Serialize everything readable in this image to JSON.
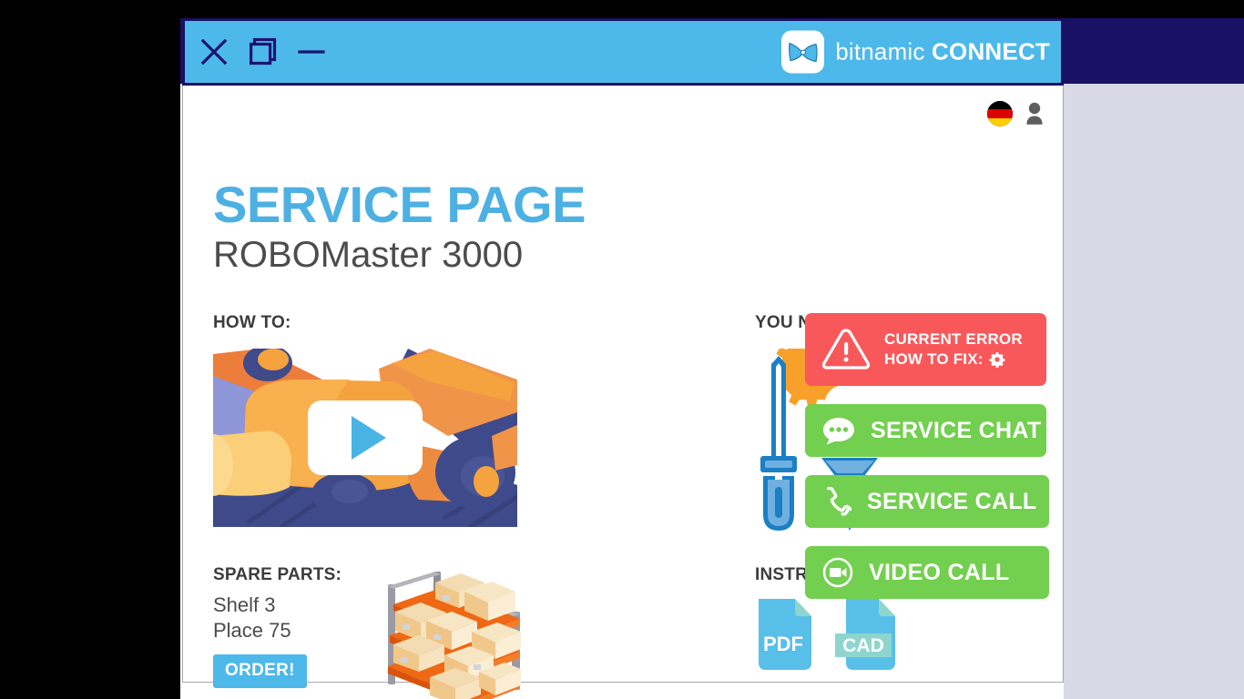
{
  "window": {
    "titlebar": {
      "close_icon": "close-x-icon",
      "restore_icon": "restore-window-icon",
      "minimize_icon": "minimize-dash-icon"
    },
    "brand": {
      "logo_icon": "bitnamic-bowtie-logo-icon",
      "name_light": "bitnamic",
      "name_bold": "CONNECT"
    }
  },
  "account": {
    "language_flag": "germany-flag-icon",
    "language_code": "DE",
    "user_icon": "user-avatar-icon"
  },
  "page": {
    "title": "SERVICE PAGE",
    "subtitle": "ROBOMaster 3000"
  },
  "sections": {
    "how_to": {
      "label": "HOW TO:",
      "video": {
        "thumbnail_alt": "robot-arm-illustration",
        "play_icon": "play-triangle-icon"
      }
    },
    "you_need": {
      "label": "YOU NEED:",
      "tools": [
        "screwdriver-icon",
        "gear-icon",
        "screw-icon"
      ]
    },
    "spare_parts": {
      "label": "SPARE PARTS:",
      "shelf": "Shelf 3",
      "place": "Place 75",
      "order_label": "ORDER!",
      "illustration": "warehouse-shelf-illustration"
    },
    "instructions": {
      "label": "INSTRUCTIONS:",
      "files": [
        {
          "name": "PDF",
          "icon": "pdf-file-icon"
        },
        {
          "name": "CAD",
          "icon": "cad-file-icon"
        }
      ]
    }
  },
  "actions": {
    "alert": {
      "icon": "warning-triangle-icon",
      "line1": "CURRENT ERROR",
      "line2": "HOW TO FIX:",
      "trailing_icon": "gear-icon"
    },
    "buttons": [
      {
        "label": "SERVICE CHAT",
        "icon": "chat-bubble-icon"
      },
      {
        "label": "SERVICE CALL",
        "icon": "phone-handset-icon"
      },
      {
        "label": "VIDEO CALL",
        "icon": "video-camera-icon"
      }
    ]
  },
  "colors": {
    "titlebar_blue": "#4db8ea",
    "border_navy": "#191163",
    "title_blue": "#4db0e3",
    "alert_red": "#f9585b",
    "action_green": "#73cf4f",
    "order_blue": "#4db8ea",
    "backdrop_lavender": "#d8d9e4",
    "gear_orange": "#f9a02a",
    "tool_blue": "#1b7fc4"
  }
}
